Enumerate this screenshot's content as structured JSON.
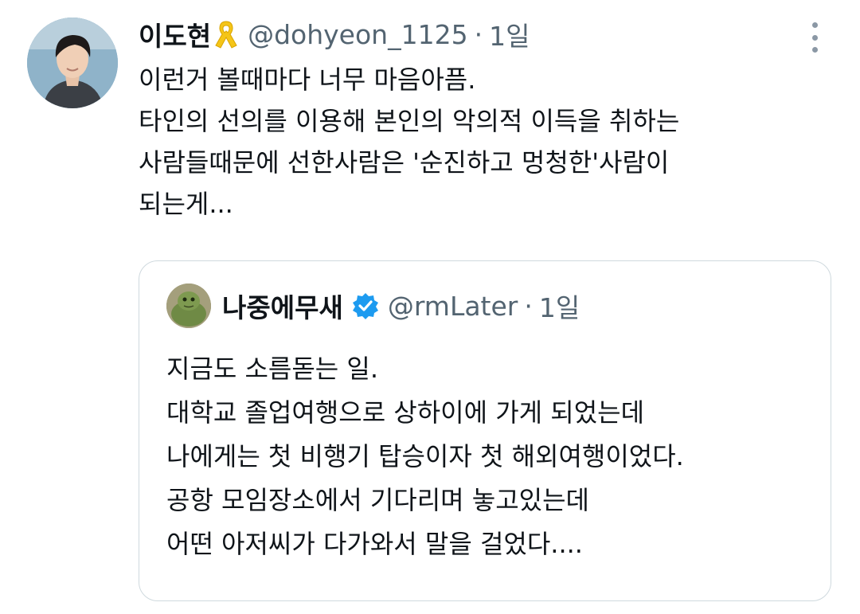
{
  "tweet": {
    "author_name": "이도현",
    "author_handle": "@dohyeon_1125",
    "separator": "·",
    "time": "1일",
    "avatar_icon": "profile-photo",
    "ribbon_icon": "yellow-ribbon-icon",
    "more_icon": "more-vertical-icon",
    "text_lines": [
      "이런거 볼때마다 너무 마음아픔.",
      "타인의 선의를 이용해 본인의 악의적 이득을 취하는",
      "사람들때문에 선한사람은 '순진하고 멍청한'사람이",
      "되는게..."
    ]
  },
  "quoted_tweet": {
    "author_name": "나중에무새",
    "author_handle": "@rmLater",
    "separator": "·",
    "time": "1일",
    "verified_icon": "verified-badge-icon",
    "verified_color": "#1d9bf0",
    "text_lines": [
      "지금도 소름돋는 일.",
      "대학교 졸업여행으로 상하이에 가게 되었는데",
      "나에게는 첫 비행기 탑승이자 첫 해외여행이었다.",
      "공항 모임장소에서 기다리며 놓고있는데",
      "어떤 아저씨가 다가와서 말을 걸었다...."
    ]
  },
  "colors": {
    "text_primary": "#0f1419",
    "text_secondary": "#536471",
    "border": "#cfd9de",
    "ribbon": "#f5c518"
  }
}
